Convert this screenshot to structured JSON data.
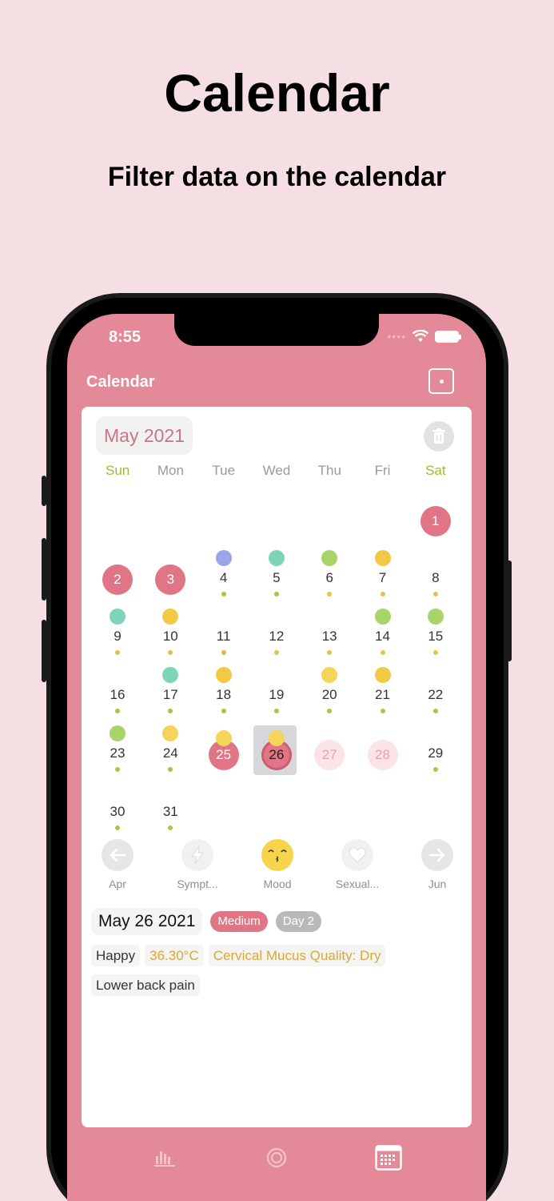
{
  "promo": {
    "title": "Calendar",
    "subtitle": "Filter data on the calendar"
  },
  "status": {
    "time": "8:55"
  },
  "nav": {
    "title": "Calendar",
    "icon": "square-dot-icon"
  },
  "calendar": {
    "month_label": "May 2021",
    "weekdays": [
      "Sun",
      "Mon",
      "Tue",
      "Wed",
      "Thu",
      "Fri",
      "Sat"
    ],
    "days": [
      {
        "d": "1",
        "style": "period"
      },
      {
        "d": "2",
        "style": "period"
      },
      {
        "d": "3",
        "style": "period"
      },
      {
        "d": "4",
        "emoji": "#9aa6e6",
        "dot": "#a3c94a"
      },
      {
        "d": "5",
        "emoji": "#7dd4b8",
        "dot": "#a3c94a"
      },
      {
        "d": "6",
        "emoji": "#a8d46a",
        "dot": "#e5c24a"
      },
      {
        "d": "7",
        "emoji": "#f1c944",
        "dot": "#e5c24a"
      },
      {
        "d": "8",
        "dot": "#e5c24a"
      },
      {
        "d": "9",
        "emoji": "#7dd4b8",
        "dot": "#e5c24a"
      },
      {
        "d": "10",
        "emoji": "#f1c944",
        "dot": "#e5c24a"
      },
      {
        "d": "11",
        "dot": "#e5b24a"
      },
      {
        "d": "12",
        "dot": "#e5c24a"
      },
      {
        "d": "13",
        "dot": "#e5c24a"
      },
      {
        "d": "14",
        "emoji": "#a8d46a",
        "dot": "#e5c24a"
      },
      {
        "d": "15",
        "emoji": "#a8d46a",
        "dot": "#e5c24a"
      },
      {
        "d": "16",
        "dot": "#a3c94a"
      },
      {
        "d": "17",
        "emoji": "#7dd4b8",
        "dot": "#a3c94a"
      },
      {
        "d": "18",
        "emoji": "#f1c944",
        "dot": "#a3c94a"
      },
      {
        "d": "19",
        "dot": "#a3c94a"
      },
      {
        "d": "20",
        "emoji": "#f5d45a",
        "dot": "#a3c94a"
      },
      {
        "d": "21",
        "emoji": "#f1c944",
        "dot": "#a3c94a"
      },
      {
        "d": "22",
        "dot": "#a3c94a"
      },
      {
        "d": "23",
        "emoji": "#a8d46a",
        "dot": "#a3c94a"
      },
      {
        "d": "24",
        "emoji": "#f5d45a",
        "dot": "#a3c94a"
      },
      {
        "d": "25",
        "emoji": "#f5d45a",
        "style": "period"
      },
      {
        "d": "26",
        "emoji": "#f5d45a",
        "style": "period",
        "selected": true
      },
      {
        "d": "27",
        "style": "predict"
      },
      {
        "d": "28",
        "style": "predict"
      },
      {
        "d": "29",
        "dot": "#a3c94a"
      },
      {
        "d": "30",
        "dot": "#a3c94a"
      },
      {
        "d": "31",
        "dot": "#a3c94a"
      }
    ]
  },
  "tools": {
    "prev": "Apr",
    "symptoms": "Sympt...",
    "mood": "Mood",
    "sexual": "Sexual...",
    "next": "Jun"
  },
  "detail": {
    "date": "May 26 2021",
    "flow": "Medium",
    "day": "Day 2",
    "tags_row1": [
      "Happy",
      "36.30°C",
      "Cervical Mucus Quality: Dry"
    ],
    "tags_row2": [
      "Lower back pain"
    ]
  },
  "colors": {
    "accent": "#e38997",
    "period": "#e07586",
    "weekend": "#98bd35"
  }
}
